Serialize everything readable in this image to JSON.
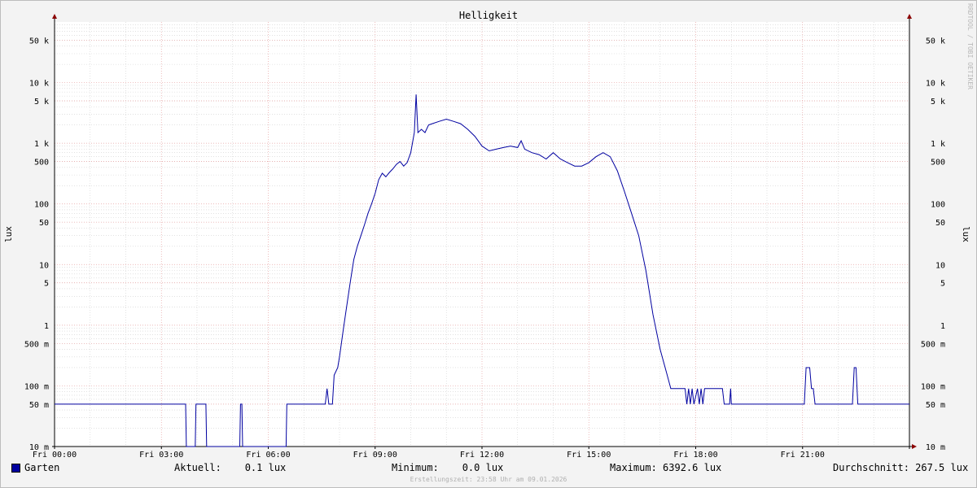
{
  "chart_data": {
    "type": "line",
    "title": "Helligkeit",
    "ylabel": "lux",
    "yscale": "log",
    "ylim": [
      0.01,
      100000
    ],
    "xlim": [
      0,
      24
    ],
    "x_unit": "hour of day",
    "grid": true,
    "xticks": [
      {
        "x": 0,
        "label": "Fri 00:00"
      },
      {
        "x": 3,
        "label": "Fri 03:00"
      },
      {
        "x": 6,
        "label": "Fri 06:00"
      },
      {
        "x": 9,
        "label": "Fri 09:00"
      },
      {
        "x": 12,
        "label": "Fri 12:00"
      },
      {
        "x": 15,
        "label": "Fri 15:00"
      },
      {
        "x": 18,
        "label": "Fri 18:00"
      },
      {
        "x": 21,
        "label": "Fri 21:00"
      }
    ],
    "yticks": [
      {
        "v": 0.01,
        "label": "10 m"
      },
      {
        "v": 0.05,
        "label": "50 m"
      },
      {
        "v": 0.1,
        "label": "100 m"
      },
      {
        "v": 0.5,
        "label": "500 m"
      },
      {
        "v": 1,
        "label": "1"
      },
      {
        "v": 5,
        "label": "5"
      },
      {
        "v": 10,
        "label": "10"
      },
      {
        "v": 50,
        "label": "50"
      },
      {
        "v": 100,
        "label": "100"
      },
      {
        "v": 500,
        "label": "500"
      },
      {
        "v": 1000,
        "label": "1 k"
      },
      {
        "v": 5000,
        "label": "5 k"
      },
      {
        "v": 10000,
        "label": "10 k"
      },
      {
        "v": 50000,
        "label": "50 k"
      }
    ],
    "series": [
      {
        "name": "Garten",
        "color": "#0000a0",
        "points": [
          [
            0.0,
            0.05
          ],
          [
            3.68,
            0.05
          ],
          [
            3.7,
            0.01
          ],
          [
            3.95,
            0.01
          ],
          [
            3.97,
            0.05
          ],
          [
            4.25,
            0.05
          ],
          [
            4.27,
            0.01
          ],
          [
            5.2,
            0.01
          ],
          [
            5.22,
            0.05
          ],
          [
            5.26,
            0.05
          ],
          [
            5.28,
            0.01
          ],
          [
            6.5,
            0.01
          ],
          [
            6.52,
            0.05
          ],
          [
            7.6,
            0.05
          ],
          [
            7.65,
            0.09
          ],
          [
            7.7,
            0.05
          ],
          [
            7.8,
            0.05
          ],
          [
            7.85,
            0.15
          ],
          [
            7.95,
            0.2
          ],
          [
            8.0,
            0.3
          ],
          [
            8.1,
            0.8
          ],
          [
            8.2,
            2
          ],
          [
            8.3,
            5
          ],
          [
            8.4,
            12
          ],
          [
            8.5,
            20
          ],
          [
            8.6,
            30
          ],
          [
            8.7,
            45
          ],
          [
            8.8,
            70
          ],
          [
            8.9,
            100
          ],
          [
            9.0,
            150
          ],
          [
            9.1,
            250
          ],
          [
            9.2,
            320
          ],
          [
            9.3,
            280
          ],
          [
            9.4,
            330
          ],
          [
            9.5,
            380
          ],
          [
            9.6,
            450
          ],
          [
            9.7,
            500
          ],
          [
            9.8,
            420
          ],
          [
            9.9,
            480
          ],
          [
            10.0,
            700
          ],
          [
            10.1,
            1500
          ],
          [
            10.15,
            6392.6
          ],
          [
            10.2,
            1500
          ],
          [
            10.3,
            1700
          ],
          [
            10.4,
            1500
          ],
          [
            10.5,
            2000
          ],
          [
            10.6,
            2100
          ],
          [
            10.8,
            2300
          ],
          [
            11.0,
            2500
          ],
          [
            11.2,
            2300
          ],
          [
            11.4,
            2100
          ],
          [
            11.6,
            1700
          ],
          [
            11.8,
            1300
          ],
          [
            12.0,
            900
          ],
          [
            12.2,
            750
          ],
          [
            12.4,
            800
          ],
          [
            12.6,
            850
          ],
          [
            12.8,
            900
          ],
          [
            13.0,
            850
          ],
          [
            13.1,
            1100
          ],
          [
            13.2,
            800
          ],
          [
            13.4,
            700
          ],
          [
            13.6,
            650
          ],
          [
            13.8,
            550
          ],
          [
            14.0,
            700
          ],
          [
            14.2,
            550
          ],
          [
            14.4,
            480
          ],
          [
            14.6,
            420
          ],
          [
            14.8,
            420
          ],
          [
            15.0,
            480
          ],
          [
            15.2,
            600
          ],
          [
            15.4,
            700
          ],
          [
            15.6,
            600
          ],
          [
            15.8,
            350
          ],
          [
            16.0,
            160
          ],
          [
            16.2,
            70
          ],
          [
            16.4,
            30
          ],
          [
            16.6,
            8
          ],
          [
            16.8,
            1.5
          ],
          [
            17.0,
            0.4
          ],
          [
            17.2,
            0.15
          ],
          [
            17.3,
            0.09
          ],
          [
            17.7,
            0.09
          ],
          [
            17.75,
            0.05
          ],
          [
            17.8,
            0.09
          ],
          [
            17.85,
            0.05
          ],
          [
            17.9,
            0.09
          ],
          [
            17.95,
            0.05
          ],
          [
            18.05,
            0.09
          ],
          [
            18.1,
            0.05
          ],
          [
            18.15,
            0.09
          ],
          [
            18.2,
            0.05
          ],
          [
            18.25,
            0.09
          ],
          [
            18.75,
            0.09
          ],
          [
            18.8,
            0.05
          ],
          [
            18.95,
            0.05
          ],
          [
            18.98,
            0.09
          ],
          [
            19.0,
            0.05
          ],
          [
            21.05,
            0.05
          ],
          [
            21.1,
            0.2
          ],
          [
            21.2,
            0.2
          ],
          [
            21.25,
            0.09
          ],
          [
            21.3,
            0.09
          ],
          [
            21.35,
            0.05
          ],
          [
            22.4,
            0.05
          ],
          [
            22.45,
            0.2
          ],
          [
            22.5,
            0.2
          ],
          [
            22.55,
            0.05
          ],
          [
            24.0,
            0.05
          ]
        ]
      }
    ]
  },
  "legend": {
    "series_name": "Garten",
    "current": "Aktuell:    0.1 lux",
    "minimum": "Minimum:    0.0 lux",
    "maximum": "Maximum: 6392.6 lux",
    "average": "Durchschnitt: 267.5 lux"
  },
  "footer": "Erstellungszeit: 23:58 Uhr am 09.01.2026",
  "watermark": "RRDTOOL / TOBI OETIKER",
  "colors": {
    "line": "#0000a0",
    "major_grid": "#e6a0a0",
    "minor_grid": "#d0d0d0",
    "plot_bg": "#ffffff",
    "axis_arrow": "#8b0000"
  }
}
